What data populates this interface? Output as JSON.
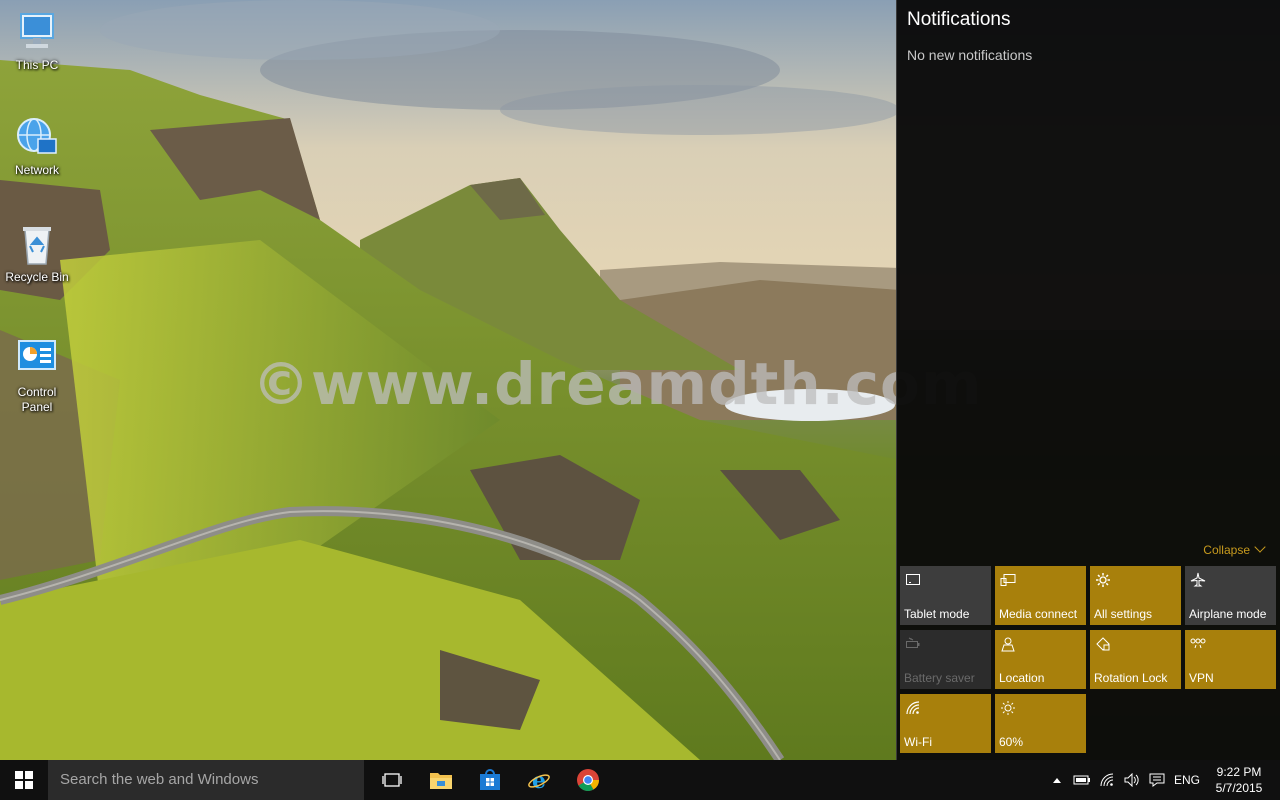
{
  "desktop": {
    "icons": [
      {
        "label": "This PC",
        "icon": "computer-icon"
      },
      {
        "label": "Network",
        "icon": "network-icon"
      },
      {
        "label": "Recycle Bin",
        "icon": "recycle-bin-icon"
      },
      {
        "label": "Control Panel",
        "icon": "control-panel-icon"
      }
    ],
    "watermark": "©www.dreamdth.com"
  },
  "action_center": {
    "title": "Notifications",
    "empty_text": "No new notifications",
    "collapse_label": "Collapse",
    "accent_color": "#a8800c",
    "quick_actions": [
      {
        "label": "Tablet mode",
        "state": "off",
        "icon": "tablet-mode-icon"
      },
      {
        "label": "Media connect",
        "state": "on",
        "icon": "media-connect-icon"
      },
      {
        "label": "All settings",
        "state": "on",
        "icon": "settings-gear-icon"
      },
      {
        "label": "Airplane mode",
        "state": "off",
        "icon": "airplane-icon"
      },
      {
        "label": "Battery saver",
        "state": "disabled",
        "icon": "battery-saver-icon"
      },
      {
        "label": "Location",
        "state": "on",
        "icon": "location-icon"
      },
      {
        "label": "Rotation Lock",
        "state": "on",
        "icon": "rotation-lock-icon"
      },
      {
        "label": "VPN",
        "state": "on",
        "icon": "vpn-icon"
      },
      {
        "label": "Wi-Fi",
        "state": "on",
        "icon": "wifi-icon"
      },
      {
        "label": "60%",
        "state": "on",
        "icon": "brightness-icon"
      }
    ]
  },
  "taskbar": {
    "search_placeholder": "Search the web and Windows",
    "apps": [
      "task-view-icon",
      "file-explorer-icon",
      "store-icon",
      "internet-explorer-icon",
      "chrome-icon"
    ],
    "tray": {
      "language": "ENG",
      "time": "9:22 PM",
      "date": "5/7/2015"
    }
  }
}
